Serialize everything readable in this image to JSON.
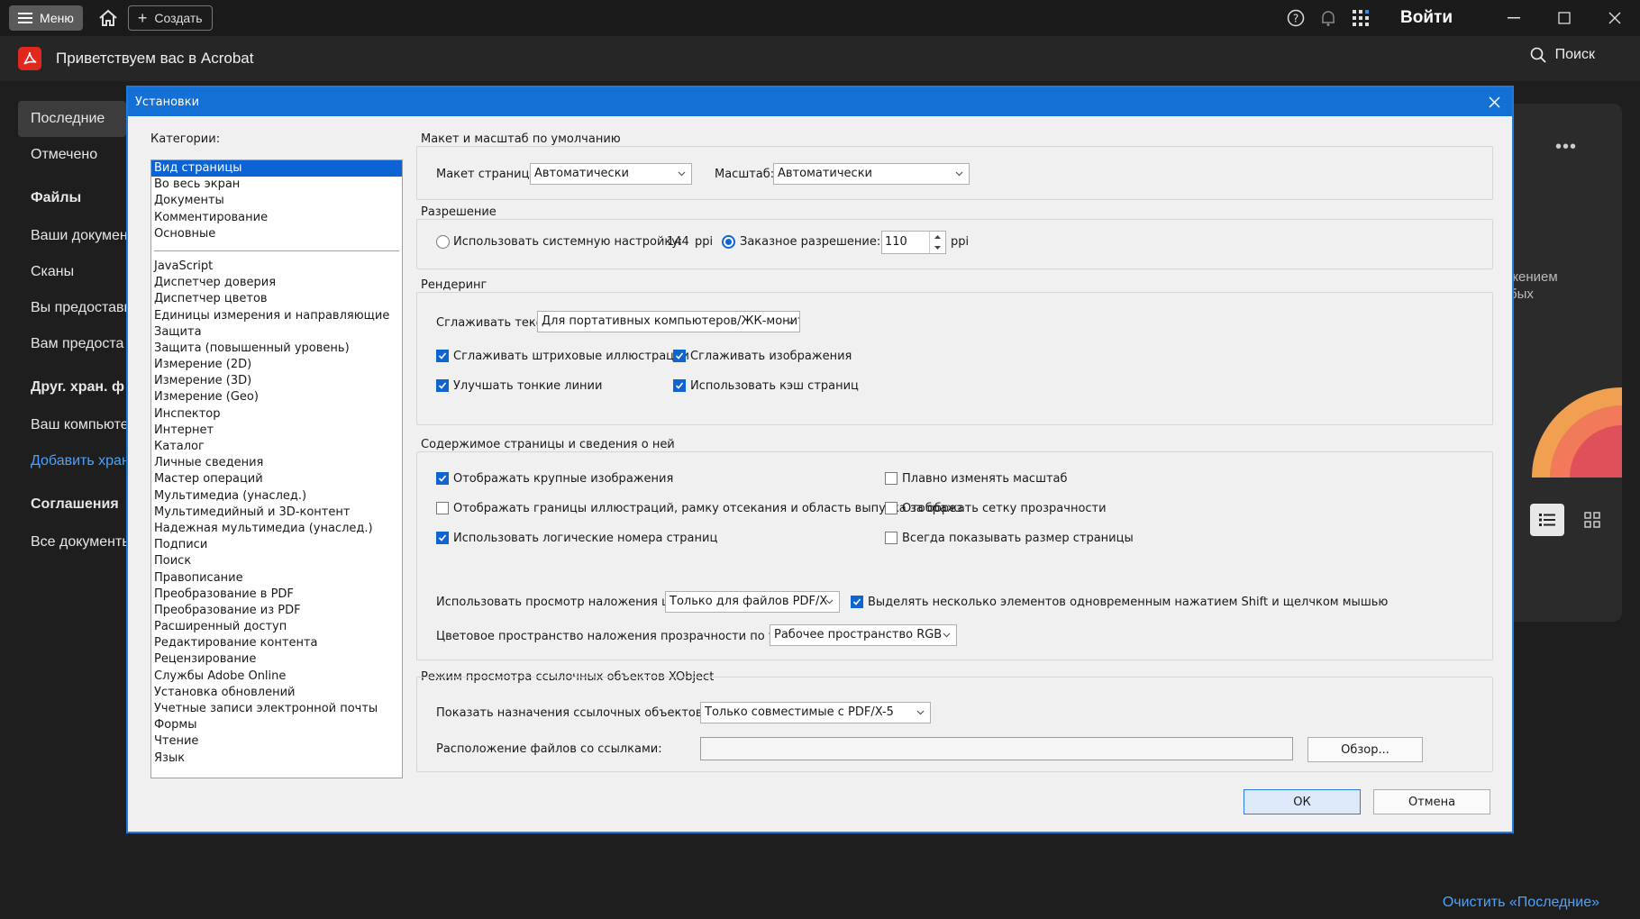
{
  "topbar": {
    "menu_label": "Меню",
    "create_label": "Создать",
    "login_label": "Войти"
  },
  "header": {
    "title": "Приветствуем вас в Acrobat",
    "search_label": "Поиск"
  },
  "sidebar": {
    "recent": "Последние",
    "starred": "Отмечено",
    "files_header": "Файлы",
    "your_docs": "Ваши докумен",
    "scans": "Сканы",
    "shared_by_you": "Вы предостави",
    "shared_with_you": "Вам предоста",
    "other_storage_header": "Друг. хран. ф",
    "your_computer": "Ваш компьюте",
    "add_storage": "Добавить хран",
    "agreements_header": "Соглашения",
    "all_docs": "Все документы"
  },
  "right_panel": {
    "text_line1": "жением",
    "text_line2": "бых",
    "more": "•••"
  },
  "footer": {
    "clear_recent": "Очистить «Последние»"
  },
  "dialog": {
    "title": "Установки",
    "categories_label": "Категории:",
    "categories_top": [
      "Вид страницы",
      "Во весь экран",
      "Документы",
      "Комментирование",
      "Основные"
    ],
    "categories": [
      "JavaScript",
      "Диспетчер доверия",
      "Диспетчер цветов",
      "Единицы измерения и направляющие",
      "Защита",
      "Защита (повышенный уровень)",
      "Измерение (2D)",
      "Измерение (3D)",
      "Измерение (Geo)",
      "Инспектор",
      "Интернет",
      "Каталог",
      "Личные сведения",
      "Мастер операций",
      "Мультимедиа (унаслед.)",
      "Мультимедийный и 3D-контент",
      "Надежная мультимедиа (унаслед.)",
      "Подписи",
      "Поиск",
      "Правописание",
      "Преобразование в PDF",
      "Преобразование из PDF",
      "Расширенный доступ",
      "Редактирование контента",
      "Рецензирование",
      "Службы Adobe Online",
      "Установка обновлений",
      "Учетные записи электронной почты",
      "Формы",
      "Чтение",
      "Язык"
    ],
    "layout": {
      "title": "Макет и масштаб по умолчанию",
      "page_layout_label": "Макет страницы:",
      "page_layout_value": "Автоматически",
      "zoom_label": "Масштаб:",
      "zoom_value": "Автоматически"
    },
    "resolution": {
      "title": "Разрешение",
      "system_label": "Использовать системную настройку:",
      "system_value": "144",
      "system_unit": "ppi",
      "custom_label": "Заказное разрешение:",
      "custom_value": "110",
      "custom_unit": "ppi",
      "selected": "custom"
    },
    "rendering": {
      "title": "Рендеринг",
      "smooth_text_label": "Сглаживать текст:",
      "smooth_text_value": "Для портативных компьютеров/ЖК-мониторов",
      "smooth_line_art": "Сглаживать штриховые иллюстрации",
      "smooth_images": "Сглаживать изображения",
      "enhance_thin_lines": "Улучшать тонкие линии",
      "use_page_cache": "Использовать кэш страниц"
    },
    "content": {
      "title": "Содержимое страницы и сведения о ней",
      "show_large_images": "Отображать крупные изображения",
      "smooth_zoom": "Плавно изменять масштаб",
      "show_art_trim_bleed": "Отображать границы иллюстраций, рамку отсекания и область выпуска за обрез",
      "show_transparency_grid": "Отображать сетку прозрачности",
      "use_logical_page_numbers": "Использовать логические номера страниц",
      "always_show_page_size": "Всегда показывать размер страницы",
      "overprint_label": "Использовать просмотр наложения цветов:",
      "overprint_value": "Только для файлов PDF/X",
      "multi_select": "Выделять несколько элементов одновременным нажатием Shift и щелчком мышью",
      "blend_space_label": "Цветовое пространство наложения прозрачности по умолчанию:",
      "blend_space_value": "Рабочее пространство RGB"
    },
    "xobject": {
      "title": "Режим просмотра ссылочных объектов XObject",
      "targets_label": "Показать назначения ссылочных объектов XObject:",
      "targets_value": "Только совместимые с PDF/X-5",
      "location_label": "Расположение файлов со ссылками:",
      "location_value": "",
      "browse_label": "Обзор..."
    },
    "ok_label": "ОК",
    "cancel_label": "Отмена"
  }
}
